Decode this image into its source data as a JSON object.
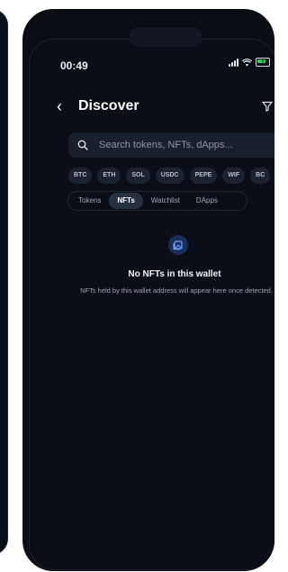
{
  "status": {
    "time": "00:49",
    "icons": [
      "signal-icon",
      "wifi-icon",
      "battery-charging-icon"
    ]
  },
  "header": {
    "title": "Discover",
    "back_icon": "chevron-left-icon",
    "filter_icon": "filter-icon"
  },
  "search": {
    "placeholder": "Search tokens, NFTs, dApps...",
    "value": ""
  },
  "tokens": [
    "BTC",
    "ETH",
    "SOL",
    "USDC",
    "PEPE",
    "WIF",
    "BC"
  ],
  "tabs": [
    {
      "label": "Tokens",
      "active": false
    },
    {
      "label": "NFTs",
      "active": true
    },
    {
      "label": "Watchlist",
      "active": false
    },
    {
      "label": "DApps",
      "active": false
    }
  ],
  "empty_state": {
    "icon": "nft-image-icon",
    "title": "No NFTs in this wallet",
    "subtitle": "NFTs held by this wallet address will appear here once detected."
  },
  "colors": {
    "background": "#0b0e16",
    "accent": "#1a2f58",
    "chip": "#1b2230",
    "active_tab": "#283142"
  }
}
